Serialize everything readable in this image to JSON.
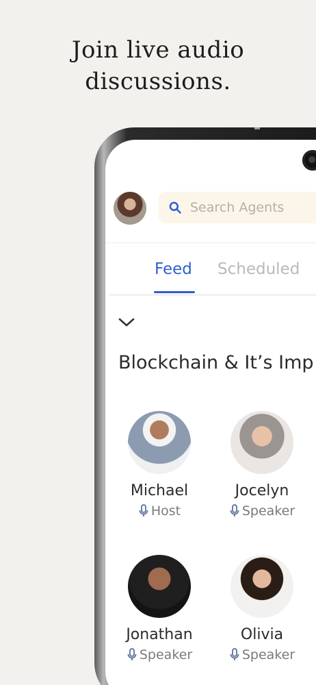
{
  "headline": {
    "line1": "Join live audio",
    "line2": "discussions."
  },
  "search": {
    "placeholder": "Search Agents"
  },
  "tabs": [
    {
      "label": "Feed",
      "active": true
    },
    {
      "label": "Scheduled",
      "active": false
    }
  ],
  "room": {
    "title": "Blockchain & It’s Imp"
  },
  "participants": [
    {
      "name": "Michael",
      "role": "Host"
    },
    {
      "name": "Jocelyn",
      "role": "Speaker"
    },
    {
      "name": "Jonathan",
      "role": "Speaker"
    },
    {
      "name": "Olivia",
      "role": "Speaker"
    }
  ],
  "colors": {
    "background": "#f2f1ee",
    "accent": "#2f5fd0",
    "search_bg": "#fbf6e9",
    "inactive_tab": "#b9b9b9"
  },
  "icons": {
    "search": "search-icon",
    "chevron": "chevron-down-icon",
    "mic": "microphone-icon"
  }
}
